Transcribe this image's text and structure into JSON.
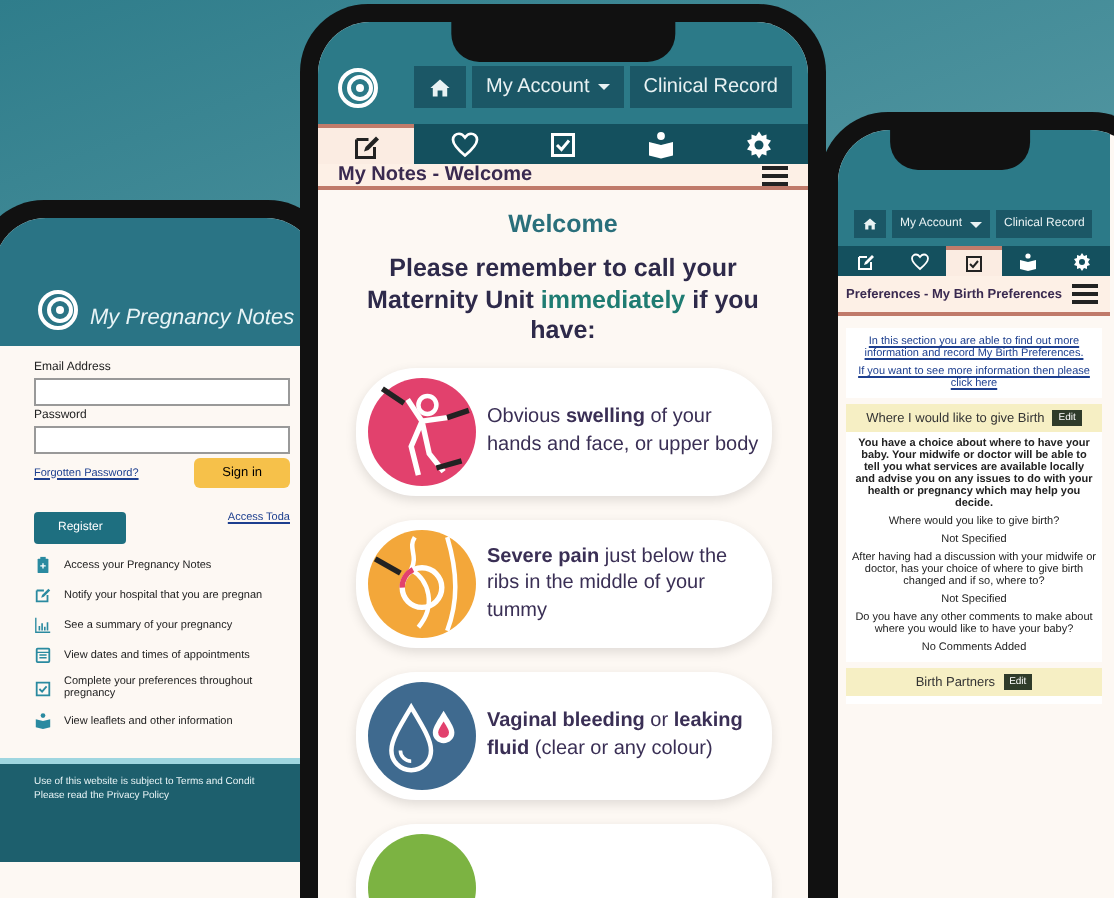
{
  "left_phone": {
    "app_title": "My Pregnancy Notes",
    "fields": [
      {
        "label": "Email Address"
      },
      {
        "label": "Password"
      }
    ],
    "sign_in": "Sign in",
    "forgot_link": "Forgotten Password?",
    "register": "Register",
    "access_link": "Access Toda",
    "features": [
      {
        "kind": "clipboard",
        "text": "Access your Pregnancy Notes"
      },
      {
        "kind": "edit",
        "text": "Notify your hospital that you are pregnan"
      },
      {
        "kind": "chart",
        "text": "See a summary of your pregnancy"
      },
      {
        "kind": "calendar",
        "text": "View dates and times of appointments"
      },
      {
        "kind": "checkbox",
        "text": "Complete your preferences throughout pregnancy"
      },
      {
        "kind": "reader",
        "text": "View leaflets and other information"
      }
    ],
    "footer": [
      "Use of this website is subject to Terms and Condit",
      "Please read the Privacy Policy"
    ]
  },
  "center_phone": {
    "nav": [
      {
        "kind": "home"
      },
      {
        "kind": "menu",
        "label": "My Account"
      },
      {
        "kind": "link",
        "label": "Clinical Record"
      }
    ],
    "tabs": [
      {
        "kind": "edit",
        "selected": true
      },
      {
        "kind": "heart",
        "selected": false
      },
      {
        "kind": "checkbox",
        "selected": false
      },
      {
        "kind": "reader",
        "selected": false
      },
      {
        "kind": "gear",
        "selected": false
      }
    ],
    "page_title": "My Notes - Welcome",
    "heading": "Welcome",
    "message": "Please remember to call your Maternity Unit **immediately** if you have:",
    "symptoms": [
      {
        "kind": "swelling",
        "text": "Obvious **swelling** of your hands and face, or upper body"
      },
      {
        "kind": "pain",
        "text": "**Severe pain** just below the ribs in the middle of your tummy"
      },
      {
        "kind": "bleeding",
        "text": "**Vaginal bleeding** or **leaking fluid** (clear or any colour)"
      },
      {
        "kind": "other"
      }
    ]
  },
  "right_phone": {
    "nav": [
      {
        "kind": "home"
      },
      {
        "kind": "menu",
        "label": "My Account"
      },
      {
        "kind": "link",
        "label": "Clinical Record"
      }
    ],
    "tabs": [
      {
        "kind": "edit",
        "selected": false
      },
      {
        "kind": "heart",
        "selected": false
      },
      {
        "kind": "checkbox",
        "selected": true
      },
      {
        "kind": "reader",
        "selected": false
      },
      {
        "kind": "gear",
        "selected": false
      }
    ],
    "page_title": "Preferences - My Birth Preferences",
    "intro_links": [
      "In this section you are able to find out more information and record My Birth Preferences.",
      "If you want to see more information then please click here"
    ],
    "sections": [
      {
        "title": "Where I would like to give Birth",
        "edit": "Edit",
        "paragraph": "You have a choice about where to have your baby. Your midwife or doctor will be able to tell you what services are available locally and advise you on any issues to do with your health or pregnancy which may help you decide.",
        "items": [
          {
            "question": "Where would you like to give birth?",
            "answer": "Not Specified"
          },
          {
            "question": "After having had a discussion with your midwife or doctor, has your choice of where to give birth changed and if so, where to?",
            "answer": "Not Specified"
          },
          {
            "question": "Do you have any other comments to make about where you would like to have your baby?",
            "answer": "No Comments Added"
          }
        ]
      },
      {
        "title": "Birth Partners",
        "edit": "Edit"
      }
    ]
  }
}
